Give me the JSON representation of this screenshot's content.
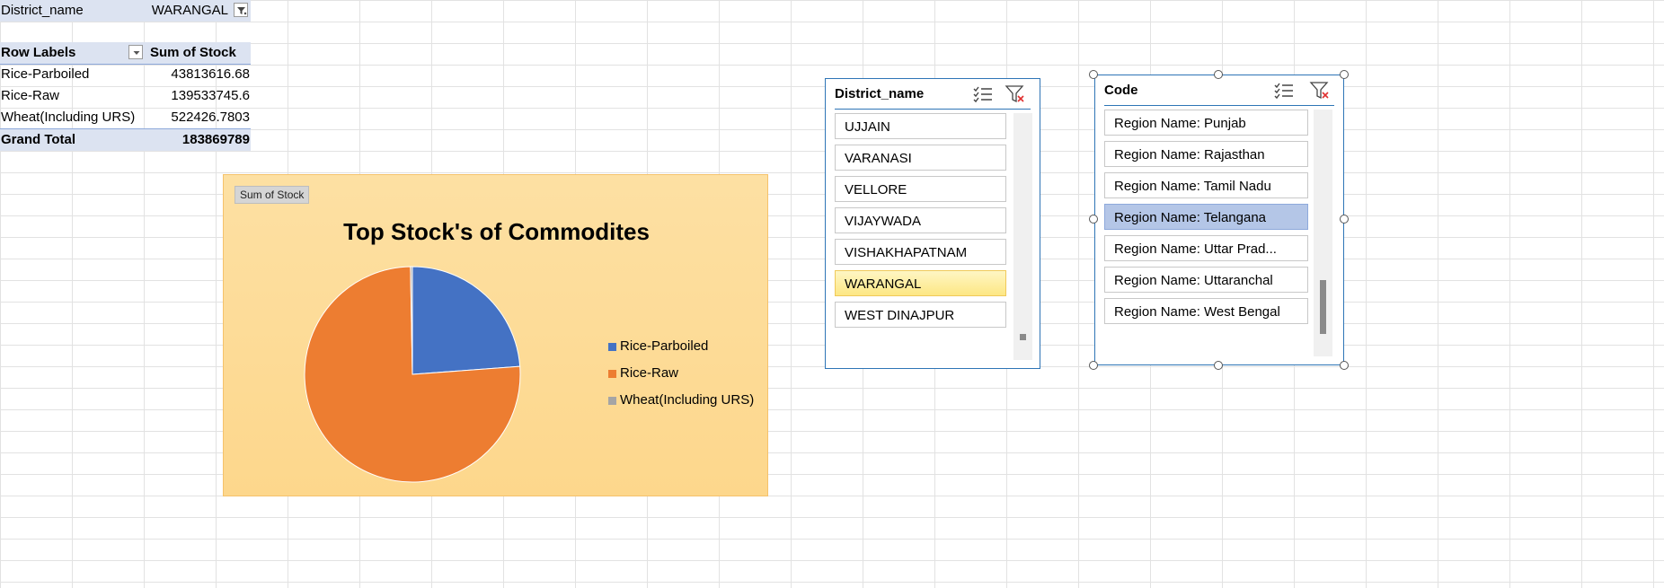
{
  "pivot": {
    "filter": {
      "field": "District_name",
      "value": "WARANGAL"
    },
    "header": {
      "row_labels": "Row Labels",
      "value_field": "Sum of Stock"
    },
    "rows": [
      {
        "label": "Rice-Parboiled",
        "value": "43813616.68"
      },
      {
        "label": "Rice-Raw",
        "value": "139533745.6"
      },
      {
        "label": "Wheat(Including URS)",
        "value": "522426.7803"
      }
    ],
    "total": {
      "label": "Grand Total",
      "value": "183869789"
    }
  },
  "chart": {
    "field_button": "Sum of Stock",
    "colors": {
      "background": "#fdd88e",
      "rice_parboiled": "#4472c4",
      "rice_raw": "#ed7d31",
      "wheat": "#a5a5a5"
    }
  },
  "chart_data": {
    "type": "pie",
    "title": "Top Stock's of Commodites",
    "categories": [
      "Rice-Parboiled",
      "Rice-Raw",
      "Wheat(Including URS)"
    ],
    "values": [
      43813616.68,
      139533745.6,
      522426.7803
    ],
    "legend_position": "right"
  },
  "slicer_district": {
    "title": "District_name",
    "items": [
      "UJJAIN",
      "VARANASI",
      "VELLORE",
      "VIJAYWADA",
      "VISHAKHAPATNAM",
      "WARANGAL",
      "WEST DINAJPUR"
    ],
    "selected": "WARANGAL",
    "icons": [
      "multi-select-icon",
      "clear-filter-icon"
    ]
  },
  "slicer_code": {
    "title": "Code",
    "items": [
      "Region Name: Punjab",
      "Region Name: Rajasthan",
      "Region Name: Tamil Nadu",
      "Region Name: Telangana",
      "Region Name: Uttar Prad...",
      "Region Name: Uttaranchal",
      "Region Name: West Bengal"
    ],
    "selected": "Region Name: Telangana",
    "icons": [
      "multi-select-icon",
      "clear-filter-icon"
    ]
  }
}
